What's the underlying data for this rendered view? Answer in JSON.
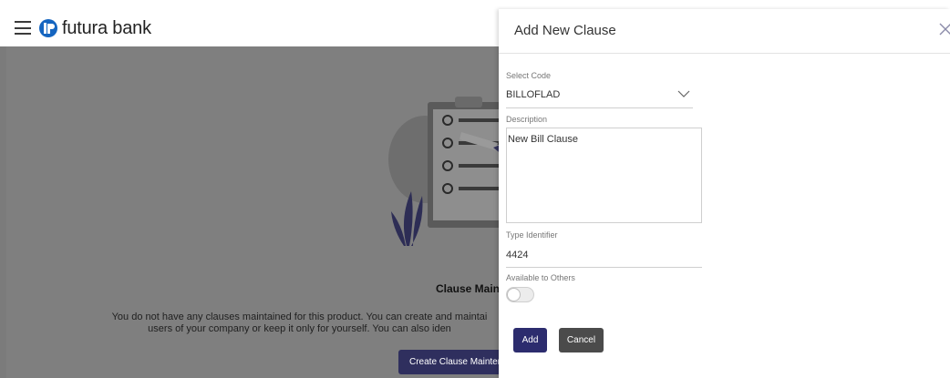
{
  "header": {
    "brand": "futura bank"
  },
  "empty_state": {
    "title": "Clause Maint",
    "message_line1": "You do not have any clauses maintained for this product. You can create and maintai",
    "message_line2": "users of your company or keep it only for yourself. You can also iden",
    "create_button": "Create Clause Maintenar"
  },
  "panel": {
    "title": "Add New Clause",
    "select_code": {
      "label": "Select Code",
      "value": "BILLOFLAD"
    },
    "description": {
      "label": "Description",
      "value": "New Bill Clause"
    },
    "type_identifier": {
      "label": "Type Identifier",
      "value": "4424"
    },
    "available_to_others": {
      "label": "Available to Others",
      "enabled": false
    },
    "add_button": "Add",
    "cancel_button": "Cancel"
  },
  "colors": {
    "overlay": "#7f7f7f",
    "primary_button": "#2c2c6e",
    "cancel_button": "#4b4b4b",
    "brand_blue": "#1565c0"
  }
}
